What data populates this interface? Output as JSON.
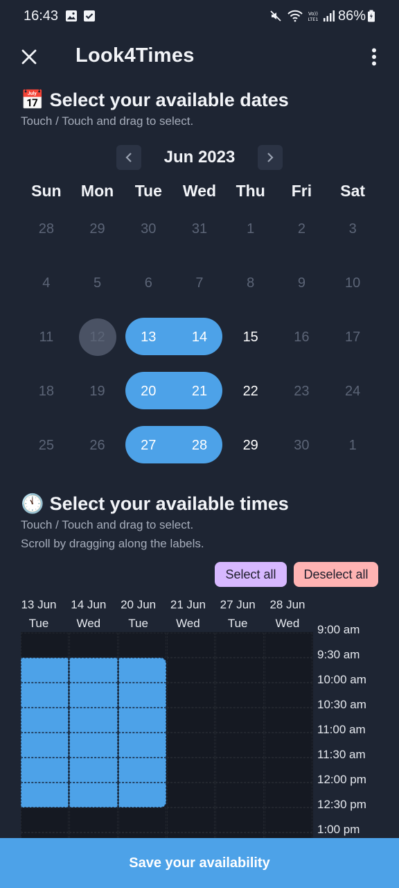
{
  "status_bar": {
    "time": "16:43",
    "battery": "86%"
  },
  "app_bar": {
    "title": "Look4Times"
  },
  "dates_section": {
    "emoji": "📅",
    "title": "Select your available dates",
    "hint": "Touch / Touch and drag to select."
  },
  "calendar": {
    "month_label": "Jun 2023",
    "weekdays": [
      "Sun",
      "Mon",
      "Tue",
      "Wed",
      "Thu",
      "Fri",
      "Sat"
    ],
    "weeks": [
      [
        "28",
        "29",
        "30",
        "31",
        "1",
        "2",
        "3"
      ],
      [
        "4",
        "5",
        "6",
        "7",
        "8",
        "9",
        "10"
      ],
      [
        "11",
        "12",
        "13",
        "14",
        "15",
        "16",
        "17"
      ],
      [
        "18",
        "19",
        "20",
        "21",
        "22",
        "23",
        "24"
      ],
      [
        "25",
        "26",
        "27",
        "28",
        "29",
        "30",
        "1"
      ]
    ],
    "today": "12",
    "available": [
      "15",
      "22",
      "29"
    ],
    "selected": [
      "13",
      "14",
      "20",
      "21",
      "27",
      "28"
    ]
  },
  "times_section": {
    "emoji": "🕚",
    "title": "Select your available times",
    "hint1": "Touch / Touch and drag to select.",
    "hint2": "Scroll by dragging along the labels.",
    "select_all": "Select all",
    "deselect_all": "Deselect all"
  },
  "time_grid": {
    "columns": [
      {
        "date": "13 Jun",
        "day": "Tue"
      },
      {
        "date": "14 Jun",
        "day": "Wed"
      },
      {
        "date": "20 Jun",
        "day": "Tue"
      },
      {
        "date": "21 Jun",
        "day": "Wed"
      },
      {
        "date": "27 Jun",
        "day": "Tue"
      },
      {
        "date": "28 Jun",
        "day": "Wed"
      }
    ],
    "time_labels": [
      "9:00 am",
      "9:30 am",
      "10:00 am",
      "10:30 am",
      "11:00 am",
      "11:30 am",
      "12:00 pm",
      "12:30 pm",
      "1:00 pm"
    ],
    "selected_rows_by_column": [
      [
        1,
        2,
        3,
        4,
        5,
        6
      ],
      [
        1,
        2,
        3,
        4,
        5,
        6
      ],
      [
        1,
        2,
        3,
        4,
        5,
        6
      ],
      [],
      [],
      []
    ]
  },
  "footer": {
    "save_label": "Save your availability"
  },
  "colors": {
    "background": "#1e2533",
    "accent": "#4da2e8",
    "select_all_bg": "#d7b8ff",
    "deselect_all_bg": "#ffb3b3"
  }
}
